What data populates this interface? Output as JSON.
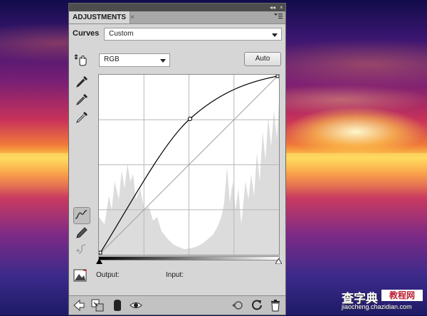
{
  "panel": {
    "tab_title": "ADJUSTMENTS",
    "tab_close": "×",
    "menu_icon": "panel-menu-icon",
    "title_collapse": "◂◂",
    "title_close": "×"
  },
  "curves": {
    "label": "Curves",
    "preset": "Custom",
    "channel": "RGB",
    "auto_label": "Auto",
    "output_label": "Output:",
    "input_label": "Input:"
  },
  "tools": [
    "hand-target-icon",
    "black-eyedropper-icon",
    "gray-eyedropper-icon",
    "white-eyedropper-icon",
    "curve-points-icon",
    "pencil-icon",
    "smooth-icon",
    "clipping-warning-icon"
  ],
  "bottom_icons": [
    "back-arrow-icon",
    "clip-to-layer-icon",
    "mask-icon",
    "visibility-eye-icon",
    "previous-state-icon",
    "reset-icon",
    "trash-icon"
  ],
  "colors": {
    "panel_bg": "#d6d6d6",
    "curve": "#000000"
  },
  "watermark": {
    "line1": "查字典",
    "line1b": "教程网",
    "line2": "jiaocheng.chazidian.com"
  }
}
